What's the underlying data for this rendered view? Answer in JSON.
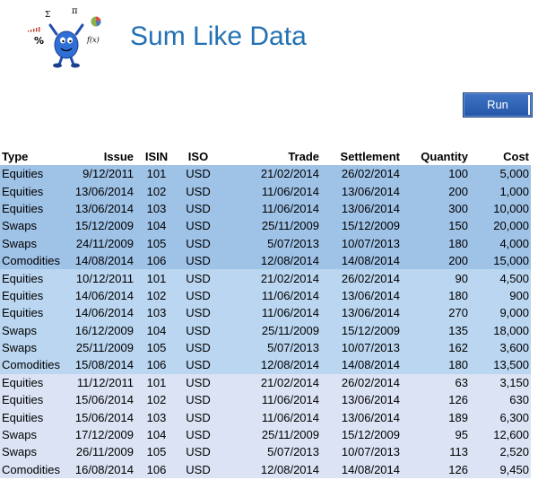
{
  "title": "Sum Like Data",
  "run_label": "Run",
  "colors": {
    "title": "#2471b3",
    "button": "#2e62b5",
    "group1": "#9fc2e7",
    "group2": "#bad6f0",
    "group3": "#dbe3f4"
  },
  "columns": [
    "Type",
    "Issue",
    "ISIN",
    "ISO",
    "Trade",
    "Settlement",
    "Quantity",
    "Cost"
  ],
  "rows": [
    {
      "group": "g1",
      "cells": [
        "Equities",
        "9/12/2011",
        "101",
        "USD",
        "21/02/2014",
        "26/02/2014",
        "100",
        "5,000"
      ]
    },
    {
      "group": "g1",
      "cells": [
        "Equities",
        "13/06/2014",
        "102",
        "USD",
        "11/06/2014",
        "13/06/2014",
        "200",
        "1,000"
      ]
    },
    {
      "group": "g1",
      "cells": [
        "Equities",
        "13/06/2014",
        "103",
        "USD",
        "11/06/2014",
        "13/06/2014",
        "300",
        "10,000"
      ]
    },
    {
      "group": "g1",
      "cells": [
        "Swaps",
        "15/12/2009",
        "104",
        "USD",
        "25/11/2009",
        "15/12/2009",
        "150",
        "20,000"
      ]
    },
    {
      "group": "g1",
      "cells": [
        "Swaps",
        "24/11/2009",
        "105",
        "USD",
        "5/07/2013",
        "10/07/2013",
        "180",
        "4,000"
      ]
    },
    {
      "group": "g1",
      "cells": [
        "Comodities",
        "14/08/2014",
        "106",
        "USD",
        "12/08/2014",
        "14/08/2014",
        "200",
        "15,000"
      ]
    },
    {
      "group": "g2",
      "cells": [
        "Equities",
        "10/12/2011",
        "101",
        "USD",
        "21/02/2014",
        "26/02/2014",
        "90",
        "4,500"
      ]
    },
    {
      "group": "g2",
      "cells": [
        "Equities",
        "14/06/2014",
        "102",
        "USD",
        "11/06/2014",
        "13/06/2014",
        "180",
        "900"
      ]
    },
    {
      "group": "g2",
      "cells": [
        "Equities",
        "14/06/2014",
        "103",
        "USD",
        "11/06/2014",
        "13/06/2014",
        "270",
        "9,000"
      ]
    },
    {
      "group": "g2",
      "cells": [
        "Swaps",
        "16/12/2009",
        "104",
        "USD",
        "25/11/2009",
        "15/12/2009",
        "135",
        "18,000"
      ]
    },
    {
      "group": "g2",
      "cells": [
        "Swaps",
        "25/11/2009",
        "105",
        "USD",
        "5/07/2013",
        "10/07/2013",
        "162",
        "3,600"
      ]
    },
    {
      "group": "g2",
      "cells": [
        "Comodities",
        "15/08/2014",
        "106",
        "USD",
        "12/08/2014",
        "14/08/2014",
        "180",
        "13,500"
      ]
    },
    {
      "group": "g3",
      "cells": [
        "Equities",
        "11/12/2011",
        "101",
        "USD",
        "21/02/2014",
        "26/02/2014",
        "63",
        "3,150"
      ]
    },
    {
      "group": "g3",
      "cells": [
        "Equities",
        "15/06/2014",
        "102",
        "USD",
        "11/06/2014",
        "13/06/2014",
        "126",
        "630"
      ]
    },
    {
      "group": "g3",
      "cells": [
        "Equities",
        "15/06/2014",
        "103",
        "USD",
        "11/06/2014",
        "13/06/2014",
        "189",
        "6,300"
      ]
    },
    {
      "group": "g3",
      "cells": [
        "Swaps",
        "17/12/2009",
        "104",
        "USD",
        "25/11/2009",
        "15/12/2009",
        "95",
        "12,600"
      ]
    },
    {
      "group": "g3",
      "cells": [
        "Swaps",
        "26/11/2009",
        "105",
        "USD",
        "5/07/2013",
        "10/07/2013",
        "113",
        "2,520"
      ]
    },
    {
      "group": "g3",
      "cells": [
        "Comodities",
        "16/08/2014",
        "106",
        "USD",
        "12/08/2014",
        "14/08/2014",
        "126",
        "9,450"
      ]
    }
  ]
}
